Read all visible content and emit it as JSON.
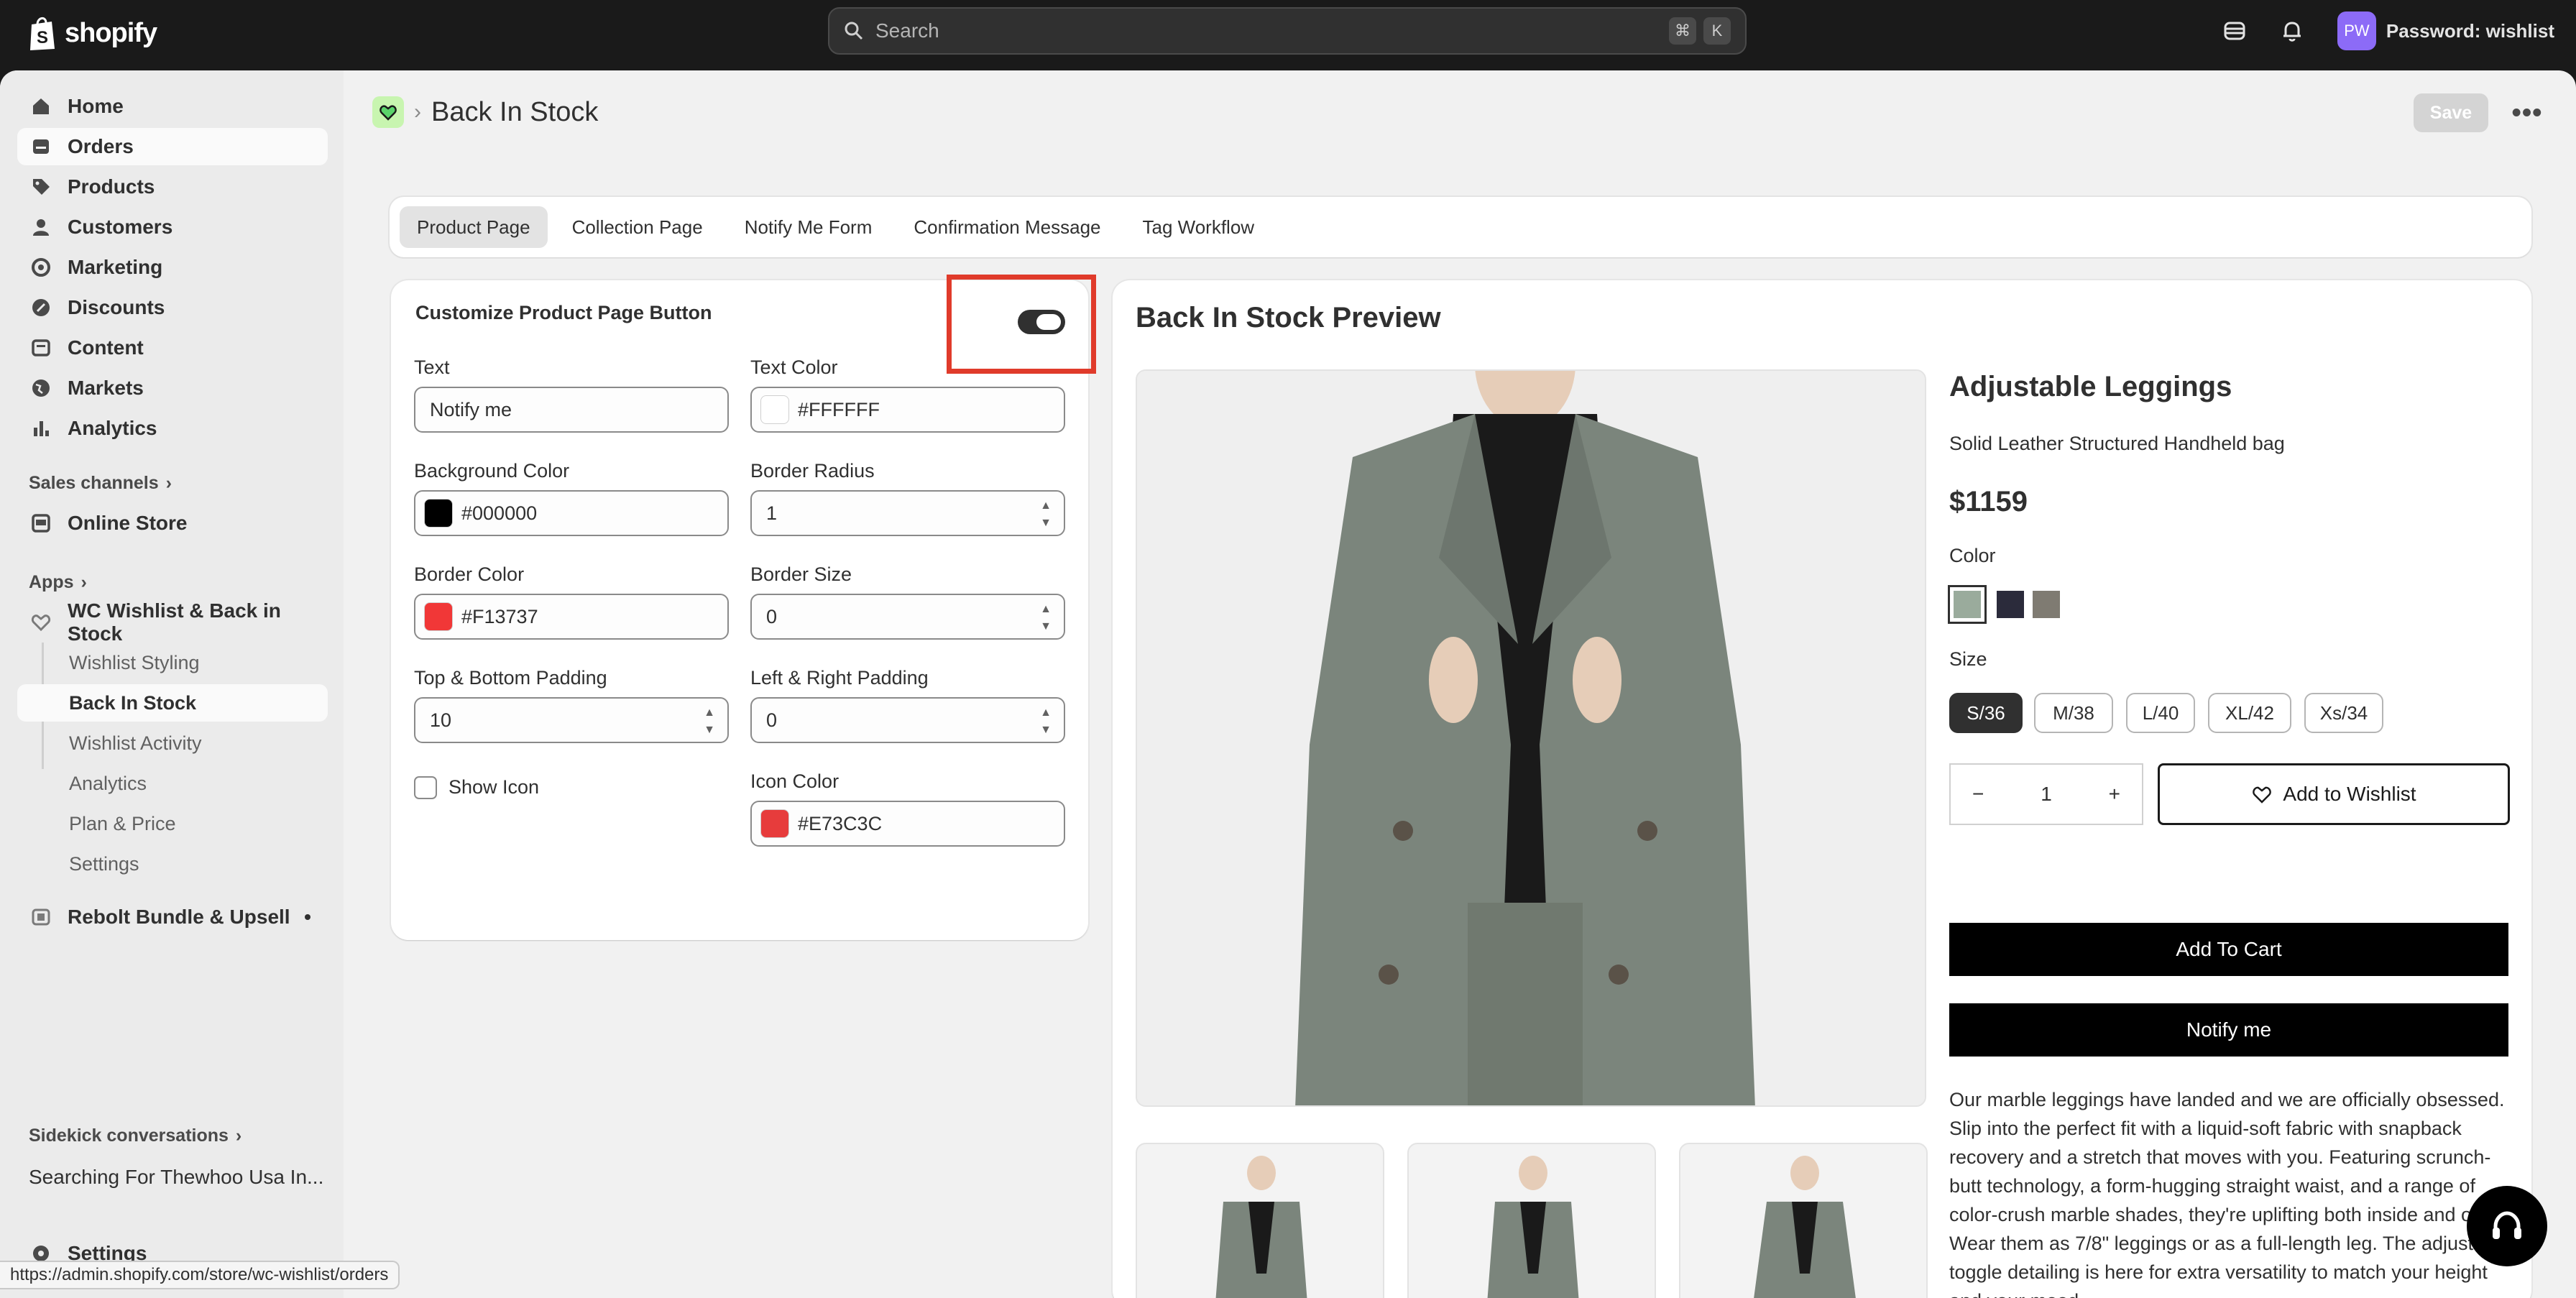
{
  "topbar": {
    "brand": "shopify",
    "search_placeholder": "Search",
    "shortcut_keys": [
      "⌘",
      "K"
    ],
    "avatar_initials": "PW",
    "store_name": "Password: wishlist"
  },
  "sidebar": {
    "main": [
      {
        "label": "Home",
        "icon": "home-icon"
      },
      {
        "label": "Orders",
        "icon": "orders-icon"
      },
      {
        "label": "Products",
        "icon": "tag-icon"
      },
      {
        "label": "Customers",
        "icon": "person-icon"
      },
      {
        "label": "Marketing",
        "icon": "target-icon"
      },
      {
        "label": "Discounts",
        "icon": "discount-icon"
      },
      {
        "label": "Content",
        "icon": "content-icon"
      },
      {
        "label": "Markets",
        "icon": "globe-icon"
      },
      {
        "label": "Analytics",
        "icon": "bar-chart-icon"
      }
    ],
    "sales_channels_label": "Sales channels",
    "online_store_label": "Online Store",
    "apps_label": "Apps",
    "app_name": "WC Wishlist & Back in Stock",
    "app_sub_items": [
      "Wishlist Styling",
      "Back In Stock",
      "Wishlist Activity",
      "Analytics",
      "Plan & Price",
      "Settings"
    ],
    "other_app": "Rebolt Bundle & Upsell",
    "sidekick_label": "Sidekick conversations",
    "sidekick_item": "Searching For Thewhoo Usa In...",
    "settings_label": "Settings"
  },
  "status_url": "https://admin.shopify.com/store/wc-wishlist/orders",
  "header": {
    "title": "Back In Stock",
    "save_label": "Save",
    "more_label": "•••"
  },
  "tabs": [
    "Product Page",
    "Collection Page",
    "Notify Me Form",
    "Confirmation Message",
    "Tag Workflow"
  ],
  "settings": {
    "title": "Customize Product Page Button",
    "toggle_on": true,
    "text_label": "Text",
    "text_value": "Notify me",
    "text_color_label": "Text Color",
    "text_color_value": "#FFFFFF",
    "bg_color_label": "Background Color",
    "bg_color_value": "#000000",
    "border_radius_label": "Border Radius",
    "border_radius_value": "1",
    "border_color_label": "Border Color",
    "border_color_value": "#F13737",
    "border_size_label": "Border Size",
    "border_size_value": "0",
    "tb_padding_label": "Top & Bottom Padding",
    "tb_padding_value": "10",
    "lr_padding_label": "Left & Right Padding",
    "lr_padding_value": "0",
    "show_icon_label": "Show Icon",
    "show_icon_checked": false,
    "icon_color_label": "Icon Color",
    "icon_color_value": "#E73C3C"
  },
  "preview": {
    "title": "Back In Stock Preview",
    "product_name": "Adjustable Leggings",
    "subtitle": "Solid Leather Structured Handheld bag",
    "price": "$1159",
    "color_label": "Color",
    "colors": [
      "#9aab9c",
      "#2b2b3b",
      "#7f7b72"
    ],
    "size_label": "Size",
    "sizes": [
      "S/36",
      "M/38",
      "L/40",
      "XL/42",
      "Xs/34"
    ],
    "selected_size": "S/36",
    "qty_minus": "−",
    "quantity": "1",
    "qty_plus": "+",
    "wishlist_label": "Add to Wishlist",
    "add_to_cart_label": "Add To Cart",
    "notify_label": "Notify me",
    "description": "Our marble leggings have landed and we are officially obsessed. Slip into the perfect fit with a liquid-soft fabric with snapback recovery and a stretch that moves with you. Featuring scrunch-butt technology, a form-hugging straight waist, and a range of color-crush marble shades, they're uplifting both inside and out. Wear them as 7/8\" leggings or as a full-length leg. The adjustable toggle detailing is here for extra versatility to match your height and your mood."
  },
  "colors": {
    "topbar": "#1a1a1a",
    "highlight": "#e03b2b",
    "avatar": "#8c6bf7"
  }
}
